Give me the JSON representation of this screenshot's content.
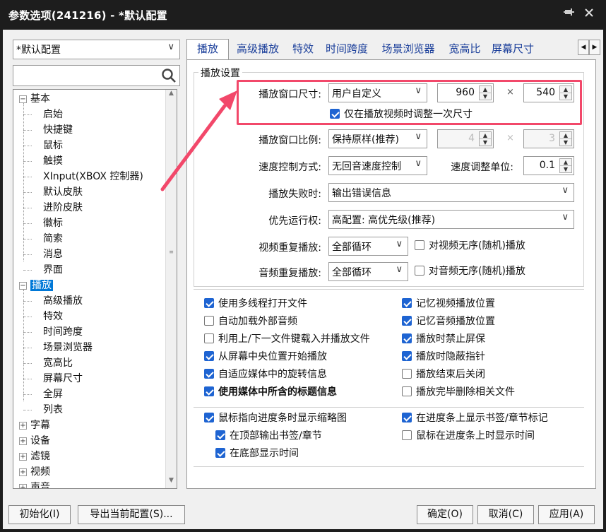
{
  "window": {
    "title": "参数选项(241216) - *默认配置",
    "pin_icon": "pin-icon",
    "close_icon": "close-icon"
  },
  "profile": {
    "selected": "*默认配置"
  },
  "search": {
    "value": "",
    "icon": "search-icon"
  },
  "tree": {
    "items": [
      {
        "label": "基本",
        "level": 0,
        "expander": "⊟"
      },
      {
        "label": "启始",
        "level": 1
      },
      {
        "label": "快捷键",
        "level": 1
      },
      {
        "label": "鼠标",
        "level": 1
      },
      {
        "label": "触摸",
        "level": 1
      },
      {
        "label": "XInput(XBOX 控制器)",
        "level": 1
      },
      {
        "label": "默认皮肤",
        "level": 1
      },
      {
        "label": "进阶皮肤",
        "level": 1
      },
      {
        "label": "徽标",
        "level": 1
      },
      {
        "label": "简索",
        "level": 1
      },
      {
        "label": "消息",
        "level": 1
      },
      {
        "label": "界面",
        "level": 1
      },
      {
        "label": "播放",
        "level": 0,
        "expander": "⊟",
        "selected": true
      },
      {
        "label": "高级播放",
        "level": 1
      },
      {
        "label": "特效",
        "level": 1
      },
      {
        "label": "时间跨度",
        "level": 1
      },
      {
        "label": "场景浏览器",
        "level": 1
      },
      {
        "label": "宽高比",
        "level": 1
      },
      {
        "label": "屏幕尺寸",
        "level": 1
      },
      {
        "label": "全屏",
        "level": 1
      },
      {
        "label": "列表",
        "level": 1
      },
      {
        "label": "字幕",
        "level": 0,
        "expander": "⊞"
      },
      {
        "label": "设备",
        "level": 0,
        "expander": "⊞"
      },
      {
        "label": "滤镜",
        "level": 0,
        "expander": "⊞"
      },
      {
        "label": "视频",
        "level": 0,
        "expander": "⊞"
      },
      {
        "label": "声音",
        "level": 0,
        "expander": "⊞"
      }
    ]
  },
  "tabs": [
    "播放",
    "高级播放",
    "特效",
    "时间跨度",
    "场景浏览器",
    "宽高比",
    "屏幕尺寸"
  ],
  "group_title": "播放设置",
  "size": {
    "label": "播放窗口尺寸:",
    "mode": "用户自定义",
    "width": "960",
    "times": "×",
    "height": "540",
    "once_label": "仅在播放视频时调整一次尺寸"
  },
  "ratio": {
    "label": "播放窗口比例:",
    "mode": "保持原样(推荐)",
    "a": "4",
    "times": "×",
    "b": "3"
  },
  "speed": {
    "label": "速度控制方式:",
    "mode": "无回音速度控制",
    "unit_label": "速度调整单位:",
    "unit": "0.1"
  },
  "fail": {
    "label": "播放失败时:",
    "mode": "输出错误信息"
  },
  "priority": {
    "label": "优先运行权:",
    "mode": "高配置: 高优先级(推荐)"
  },
  "video_repeat": {
    "label": "视频重复播放:",
    "mode": "全部循环",
    "shuffle_label": "对视频无序(随机)播放"
  },
  "audio_repeat": {
    "label": "音频重复播放:",
    "mode": "全部循环",
    "shuffle_label": "对音频无序(随机)播放"
  },
  "checks_left": [
    {
      "label": "使用多线程打开文件",
      "checked": true
    },
    {
      "label": "自动加载外部音频",
      "checked": false
    },
    {
      "label": "利用上/下一文件键载入并播放文件",
      "checked": false
    },
    {
      "label": "从屏幕中央位置开始播放",
      "checked": true
    },
    {
      "label": "自适应媒体中的旋转信息",
      "checked": true
    },
    {
      "label": "使用媒体中所含的标题信息",
      "checked": true,
      "bold": true
    }
  ],
  "checks_right": [
    {
      "label": "记忆视频播放位置",
      "checked": true
    },
    {
      "label": "记忆音频播放位置",
      "checked": true
    },
    {
      "label": "播放时禁止屏保",
      "checked": true
    },
    {
      "label": "播放时隐蔽指针",
      "checked": true
    },
    {
      "label": "播放结束后关闭",
      "checked": false
    },
    {
      "label": "播放完毕删除相关文件",
      "checked": false
    }
  ],
  "thumb": {
    "label": "鼠标指向进度条时显示缩略图",
    "top_label": "在顶部输出书签/章节",
    "bottom_label": "在底部显示时间"
  },
  "bookmark": {
    "label": "在进度条上显示书签/章节标记",
    "time_label": "鼠标在进度条上时显示时间"
  },
  "buttons": {
    "init": "初始化(I)",
    "export": "导出当前配置(S)...",
    "ok": "确定(O)",
    "cancel": "取消(C)",
    "apply": "应用(A)"
  },
  "colors": {
    "accent": "#0078d7",
    "highlight": "#f2486a",
    "titlebar": "#1d1d1d"
  }
}
